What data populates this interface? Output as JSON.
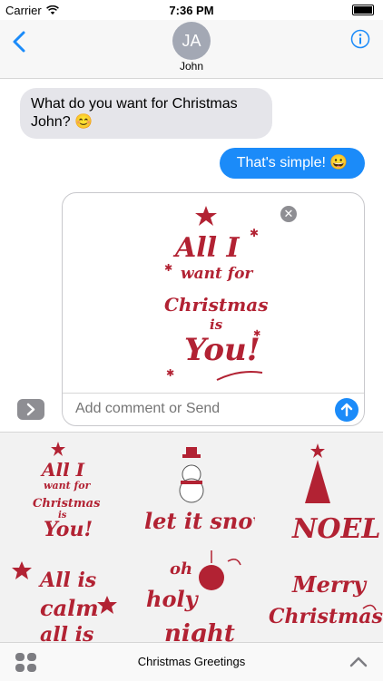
{
  "status": {
    "carrier": "Carrier",
    "time": "7:36 PM"
  },
  "contact": {
    "initials": "JA",
    "name": "John"
  },
  "messages": {
    "incoming": "What do you want for Christmas John? 😊",
    "outgoing": "That's simple! 😀"
  },
  "composer": {
    "placeholder": "Add comment or Send",
    "sticker_main": [
      "All I",
      "want for",
      "Christmas",
      "is",
      "You!"
    ]
  },
  "stickers": [
    {
      "lines": [
        "All I",
        "want for",
        "Christmas",
        "is",
        "You!"
      ]
    },
    {
      "lines": [
        "let it snow"
      ]
    },
    {
      "lines": [
        "NOEL"
      ]
    },
    {
      "lines": [
        "All is",
        "calm",
        "all is"
      ]
    },
    {
      "lines": [
        "oh",
        "holy",
        "night"
      ]
    },
    {
      "lines": [
        "Merry",
        "Christmas"
      ]
    }
  ],
  "bottom_bar": {
    "title": "Christmas Greetings"
  },
  "colors": {
    "accent": "#1b8bf9",
    "sticker_red": "#b22233",
    "incoming_bubble": "#e5e5ea"
  }
}
